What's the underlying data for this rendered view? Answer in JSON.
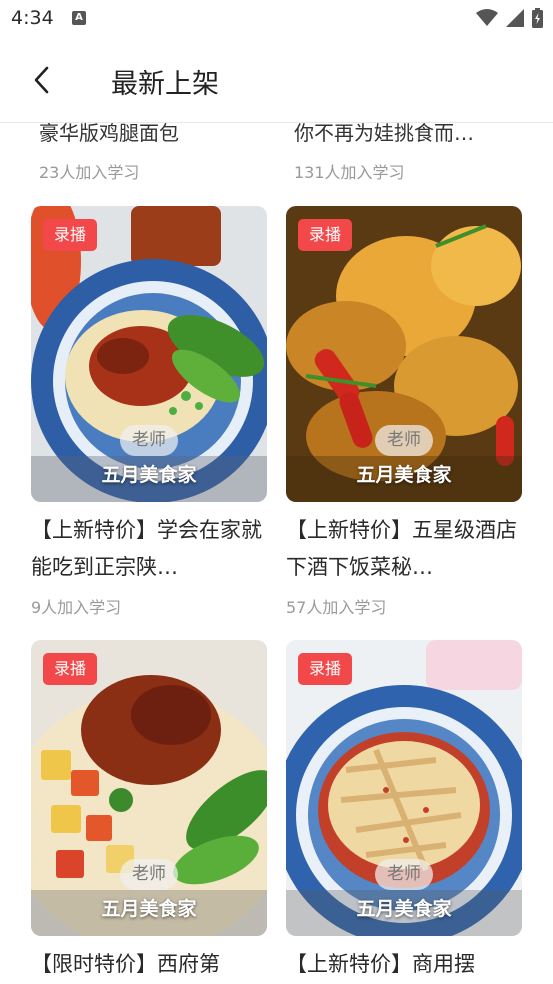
{
  "status_bar": {
    "time": "4:34",
    "a_icon": "A"
  },
  "header": {
    "title": "最新上架"
  },
  "previous_row": [
    {
      "title": "豪华版鸡腿面包",
      "count": "23人加入学习"
    },
    {
      "title": "你不再为娃挑食而…",
      "count": "131人加入学习"
    }
  ],
  "cards": [
    {
      "badge": "录播",
      "teacher_tag": "老师",
      "teacher_name": "五月美食家",
      "title": "【上新特价】学会在家就能吃到正宗陕…",
      "count": "9人加入学习"
    },
    {
      "badge": "录播",
      "teacher_tag": "老师",
      "teacher_name": "五月美食家",
      "title": "【上新特价】五星级酒店下酒下饭菜秘…",
      "count": "57人加入学习"
    },
    {
      "badge": "录播",
      "teacher_tag": "老师",
      "teacher_name": "五月美食家",
      "title": "【限时特价】西府第",
      "count": ""
    },
    {
      "badge": "录播",
      "teacher_tag": "老师",
      "teacher_name": "五月美食家",
      "title": "【上新特价】商用摆",
      "count": ""
    }
  ],
  "colors": {
    "badge_bg": "#f2484a",
    "muted_text": "#999999"
  }
}
